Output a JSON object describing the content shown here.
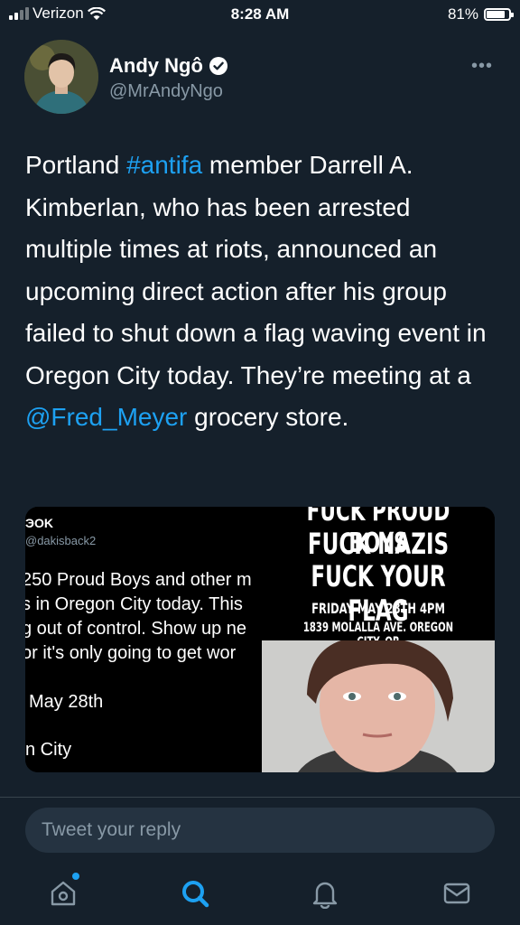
{
  "status_bar": {
    "carrier": "Verizon",
    "time": "8:28 AM",
    "battery": "81%",
    "battery_level": 0.81
  },
  "tweet": {
    "author_name": "Andy Ngô",
    "handle": "@MrAndyNgo",
    "text_parts": {
      "p1": "Portland ",
      "hashtag": "#antifa",
      "p2": " member Darrell A. Kimberlan, who has been arrested multiple times at riots, announced an upcoming direct action after his group failed to shut down a flag waving event in Oregon City today. They’re meeting at a ",
      "mention": "@Fred_Meyer",
      "p3": " grocery store."
    }
  },
  "media": {
    "left_post": {
      "name_fragment": "ЭOK",
      "handle_fragment": "@dakisback2",
      "lines": [
        "250 Proud Boys and other m",
        "s in Oregon City today. This",
        "g out of control. Show up ne",
        "or it's only going to get wor"
      ],
      "date_line": "May 28th",
      "location_line": "n City"
    },
    "poster": {
      "line1": "FUCK PROUD BOYS",
      "line2": "FUCK NAZIS",
      "line3": "FUCK YOUR FLAG",
      "line4": "FRIDAY MAY 28TH 4PM",
      "line5": "1839 MOLALLA AVE. OREGON CITY, OR"
    }
  },
  "reply": {
    "placeholder": "Tweet your reply"
  },
  "tabbar": {
    "tabs": [
      {
        "icon": "home-icon",
        "active": false,
        "notification_dot": true
      },
      {
        "icon": "search-icon",
        "active": true
      },
      {
        "icon": "bell-icon",
        "active": false
      },
      {
        "icon": "mail-icon",
        "active": false
      }
    ]
  },
  "colors": {
    "background": "#15202b",
    "accent": "#1da1f2",
    "secondary_text": "#8899a6"
  }
}
